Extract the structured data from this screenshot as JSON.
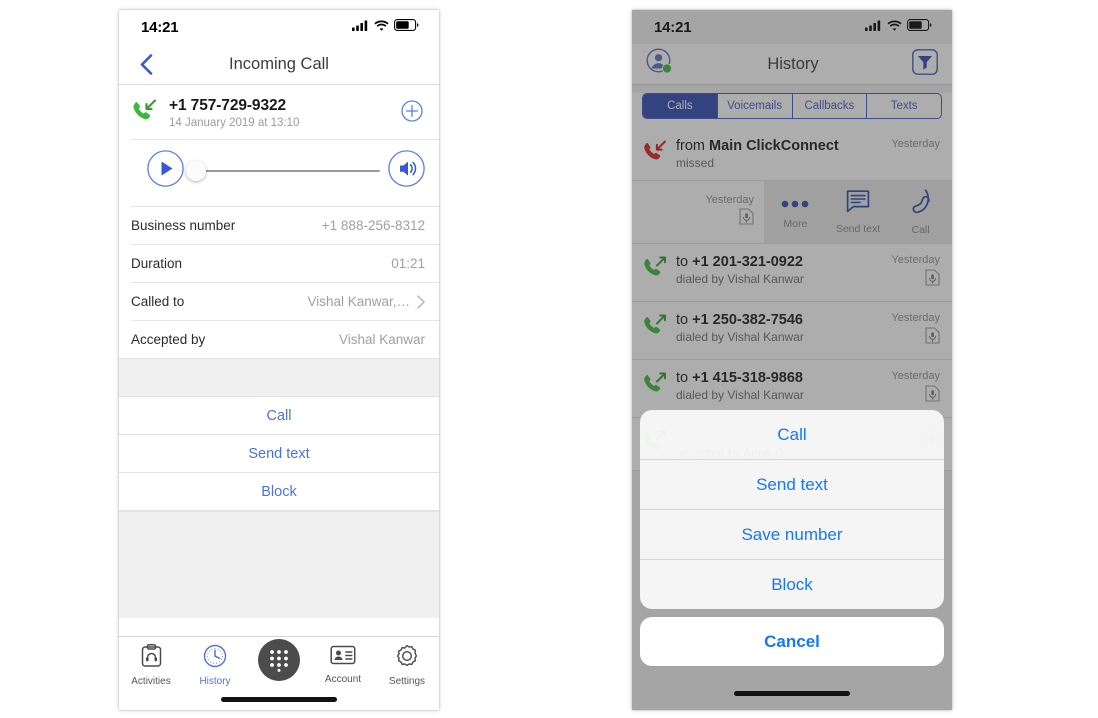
{
  "left_phone": {
    "status_bar": {
      "time": "14:21",
      "signal_icon": "cellular-signal-icon",
      "wifi_icon": "wifi-icon",
      "battery_icon": "battery-icon"
    },
    "navbar": {
      "back_icon": "chevron-left-icon",
      "title": "Incoming Call"
    },
    "call_header": {
      "direction_icon": "incoming-call-icon",
      "number": "+1 757-729-9322",
      "datetime": "14 January 2019 at 13:10",
      "add_icon": "plus-circle-icon"
    },
    "player": {
      "play_icon": "play-icon",
      "volume_icon": "speaker-icon",
      "progress_percent": 0
    },
    "details": [
      {
        "label": "Business number",
        "value": "+1 888-256-8312",
        "chevron": false
      },
      {
        "label": "Duration",
        "value": "01:21",
        "chevron": false
      },
      {
        "label": "Called to",
        "value": "Vishal Kanwar,…",
        "chevron": true
      },
      {
        "label": "Accepted by",
        "value": "Vishal Kanwar",
        "chevron": false
      }
    ],
    "actions": [
      {
        "label": "Call"
      },
      {
        "label": "Send text"
      },
      {
        "label": "Block"
      }
    ],
    "tabbar": [
      {
        "label": "Activities",
        "icon": "activities-icon",
        "active": false
      },
      {
        "label": "History",
        "icon": "clock-icon",
        "active": true
      },
      {
        "label": "",
        "icon": "dialpad-icon",
        "active": false
      },
      {
        "label": "Account",
        "icon": "contact-card-icon",
        "active": false
      },
      {
        "label": "Settings",
        "icon": "gear-icon",
        "active": false
      }
    ]
  },
  "right_phone": {
    "status_bar": {
      "time": "14:21",
      "signal_icon": "cellular-signal-icon",
      "wifi_icon": "wifi-icon",
      "battery_icon": "battery-icon"
    },
    "navbar": {
      "avatar_icon": "avatar-online-icon",
      "title": "History",
      "filter_icon": "filter-funnel-icon"
    },
    "segments": [
      {
        "label": "Calls",
        "selected": true
      },
      {
        "label": "Voicemails",
        "selected": false
      },
      {
        "label": "Callbacks",
        "selected": false
      },
      {
        "label": "Texts",
        "selected": false
      }
    ],
    "history_rows": [
      {
        "icon": "missed-call-icon",
        "prefix": "from ",
        "name": "Main ClickConnect",
        "sub": "missed",
        "when": "Yesterday",
        "recording": false
      },
      {
        "icon": "outgoing-call-icon",
        "prefix": "to ",
        "name": "+1 201-321-0922",
        "sub": "dialed by Vishal Kanwar",
        "when": "Yesterday",
        "recording": true
      },
      {
        "icon": "outgoing-call-icon",
        "prefix": "to ",
        "name": "+1 250-382-7546",
        "sub": "dialed by Vishal Kanwar",
        "when": "Yesterday",
        "recording": true
      },
      {
        "icon": "outgoing-call-icon",
        "prefix": "to ",
        "name": "+1 415-318-9868",
        "sub": "dialed by Vishal Kanwar",
        "when": "Yesterday",
        "recording": true
      }
    ],
    "swipe_row": {
      "when": "Yesterday",
      "recording_icon": "recording-doc-icon",
      "actions": [
        {
          "label": "More",
          "icon": "more-dots-icon"
        },
        {
          "label": "Send text",
          "icon": "message-bubble-icon"
        },
        {
          "label": "Call",
          "icon": "phone-handset-icon"
        }
      ]
    },
    "obscured_row": {
      "sub": "accepted by Anna O"
    },
    "action_sheet": {
      "items": [
        {
          "label": "Call"
        },
        {
          "label": "Send text"
        },
        {
          "label": "Save number"
        },
        {
          "label": "Block"
        }
      ],
      "cancel_label": "Cancel"
    }
  },
  "colors": {
    "accent_blue": "#4a72e8",
    "ios_blue": "#1477ff",
    "segment_blue": "#2f48b0",
    "green": "#3db83d",
    "red": "#e02020",
    "gray_bg": "#f0f0f0"
  }
}
